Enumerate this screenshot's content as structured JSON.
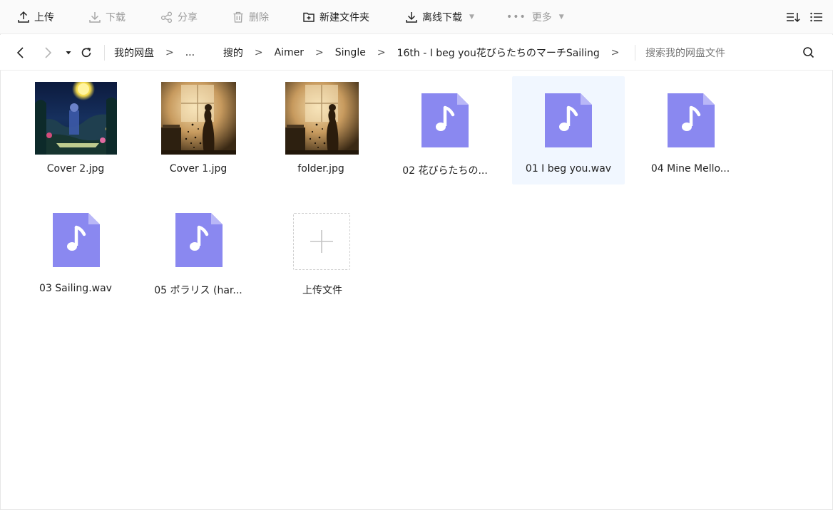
{
  "toolbar": {
    "upload": "上传",
    "download": "下载",
    "share": "分享",
    "delete": "删除",
    "new_folder": "新建文件夹",
    "offline_download": "离线下载",
    "more": "更多"
  },
  "breadcrumb": {
    "root": "我的网盘",
    "sep": ">",
    "ellipsis": "...",
    "items": [
      "搜的",
      "Aimer",
      "Single",
      "16th - I beg you花びらたちのマーチSailing"
    ]
  },
  "search": {
    "placeholder": "搜索我的网盘文件"
  },
  "files": [
    {
      "name": "Cover 2.jpg",
      "kind": "image",
      "selected": false
    },
    {
      "name": "Cover 1.jpg",
      "kind": "image",
      "selected": false
    },
    {
      "name": "folder.jpg",
      "kind": "image",
      "selected": false
    },
    {
      "name": "02 花びらたちの...",
      "kind": "audio",
      "selected": false
    },
    {
      "name": "01 I beg you.wav",
      "kind": "audio",
      "selected": true
    },
    {
      "name": "04 Mine Mello...",
      "kind": "audio",
      "selected": false
    },
    {
      "name": "03 Sailing.wav",
      "kind": "audio",
      "selected": false
    },
    {
      "name": "05 ポラリス (har...",
      "kind": "audio",
      "selected": false
    }
  ],
  "upload_tile": {
    "label": "上传文件"
  },
  "colors": {
    "accent_audio": "#8a88f0",
    "accent_audio_fold": "#b9b7f7",
    "selected_bg": "#f1f7ff",
    "toolbar_bg": "#fafafa"
  }
}
